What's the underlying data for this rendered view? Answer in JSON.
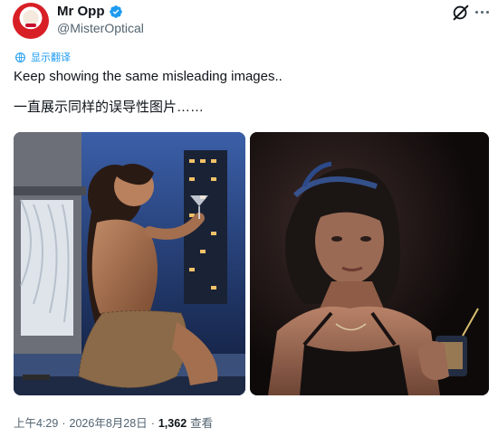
{
  "author": {
    "display_name": "Mr Opp",
    "handle": "@MisterOptical",
    "avatar_icon": "clown-avatar",
    "verified_color": "#1d9bf0"
  },
  "header_actions": {
    "grok_icon": "grok-icon",
    "more_icon": "more-dots-icon"
  },
  "translate": {
    "icon": "translate-globe-icon",
    "label": "显示翻译",
    "color": "#1d9bf0"
  },
  "tweet": {
    "text_en": "Keep showing the same misleading images..",
    "text_zh": "一直展示同样的误导性图片……"
  },
  "media": [
    {
      "kind": "photo"
    },
    {
      "kind": "photo"
    }
  ],
  "meta": {
    "time": "上午4:29",
    "separator": " · ",
    "date": "2026年8月28日",
    "views_count": "1,362",
    "views_label": "查看"
  }
}
